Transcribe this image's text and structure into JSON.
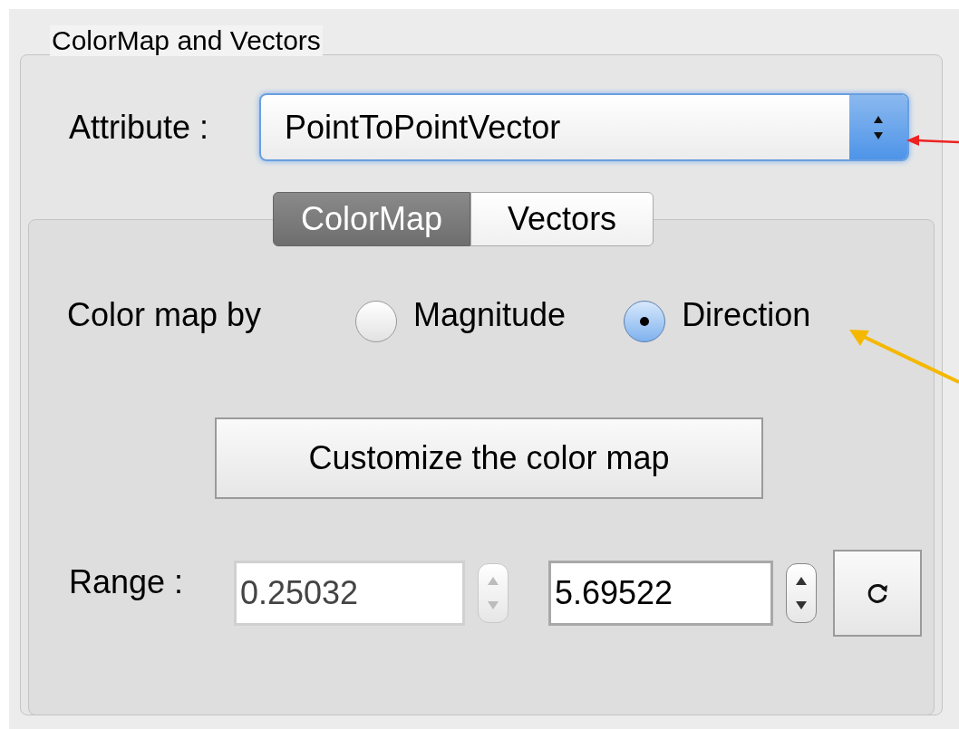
{
  "group": {
    "title": "ColorMap and Vectors"
  },
  "attribute": {
    "label": "Attribute :",
    "value": "PointToPointVector"
  },
  "tabs": [
    {
      "label": "ColorMap",
      "selected": true
    },
    {
      "label": "Vectors",
      "selected": false
    }
  ],
  "color_map_by": {
    "label": "Color map by",
    "options": [
      {
        "label": "Magnitude",
        "selected": false
      },
      {
        "label": "Direction",
        "selected": true
      }
    ]
  },
  "customize_button": "Customize the color map",
  "range": {
    "label": "Range :",
    "fields": [
      {
        "value": "0.25032",
        "disabled": true
      },
      {
        "value": "5.69522",
        "disabled": false
      }
    ]
  },
  "annotation_arrows": [
    {
      "color": "#ee2222"
    },
    {
      "color": "#f5b800"
    }
  ]
}
